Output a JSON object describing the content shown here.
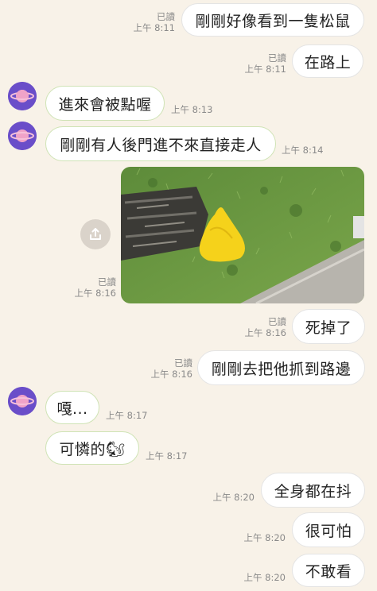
{
  "messages": [
    {
      "side": "out",
      "text": "剛剛好像看到一隻松鼠",
      "read": "已讀",
      "time": "上午 8:11"
    },
    {
      "side": "out",
      "text": "在路上",
      "read": "已讀",
      "time": "上午 8:11"
    },
    {
      "side": "in",
      "text": "進來會被點喔",
      "time": "上午 8:13"
    },
    {
      "side": "in",
      "text": "剛剛有人後門進不來直接走人",
      "time": "上午 8:14"
    },
    {
      "side": "out",
      "type": "photo",
      "read": "已讀",
      "time": "上午 8:16"
    },
    {
      "side": "out",
      "text": "死掉了",
      "read": "已讀",
      "time": "上午 8:16"
    },
    {
      "side": "out",
      "text": "剛剛去把他抓到路邊",
      "read": "已讀",
      "time": "上午 8:16"
    },
    {
      "side": "in",
      "text": "嘎...",
      "time": "上午 8:17"
    },
    {
      "side": "in",
      "text": "可憐的🐿",
      "time": "上午 8:17"
    },
    {
      "side": "out",
      "text": "全身都在抖",
      "time": "上午 8:20"
    },
    {
      "side": "out",
      "text": "很可怕",
      "time": "上午 8:20"
    },
    {
      "side": "out",
      "text": "不敢看",
      "time": "上午 8:20"
    }
  ],
  "icons": {
    "avatar": "planet-avatar-icon",
    "share": "share-icon"
  },
  "colors": {
    "background": "#f8f2e8",
    "avatar": "#6a4ec9",
    "planet": "#f0a3c8",
    "incoming_border": "#cfe3b5"
  }
}
